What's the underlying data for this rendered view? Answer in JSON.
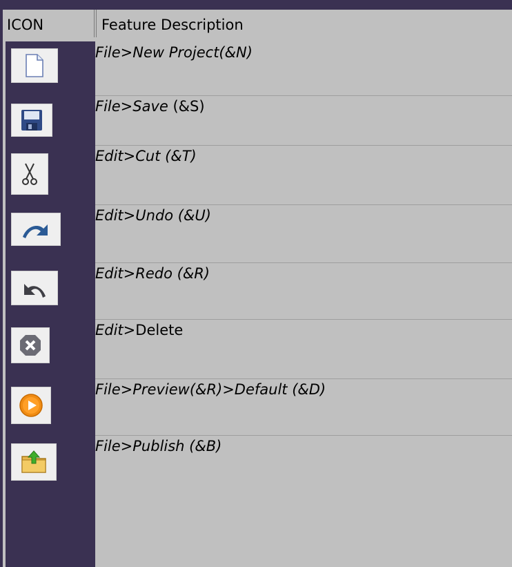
{
  "header": {
    "icon_col": "ICON",
    "desc_col": "Feature Description"
  },
  "rows": [
    {
      "icon": "new-file-icon",
      "label": "File>New Project(&N)"
    },
    {
      "icon": "save-floppy-icon",
      "label_italic": "File>Save",
      "label_plain": " (&S)"
    },
    {
      "icon": "scissors-icon",
      "label": "Edit>Cut (&T)"
    },
    {
      "icon": "undo-arrow-icon",
      "label": "Edit>Undo (&U)"
    },
    {
      "icon": "redo-arrow-icon",
      "label": "Edit>Redo (&R)"
    },
    {
      "icon": "delete-x-icon",
      "label_italic": "Edit",
      "label_plain": ">Delete"
    },
    {
      "icon": "preview-play-icon",
      "label": "File>Preview(&R)>Default (&D)"
    },
    {
      "icon": "publish-folder-icon",
      "label": "File>Publish (&B)"
    }
  ]
}
